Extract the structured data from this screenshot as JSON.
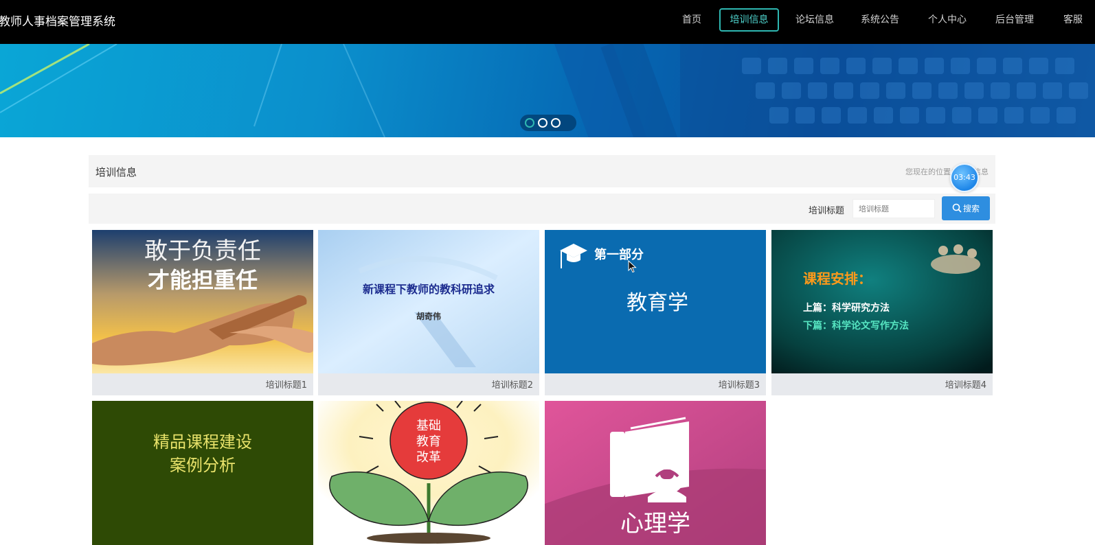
{
  "app": {
    "title": "教师人事档案管理系统"
  },
  "nav": {
    "items": [
      {
        "label": "首页",
        "active": false
      },
      {
        "label": "培训信息",
        "active": true
      },
      {
        "label": "论坛信息",
        "active": false
      },
      {
        "label": "系统公告",
        "active": false
      },
      {
        "label": "个人中心",
        "active": false
      },
      {
        "label": "后台管理",
        "active": false
      },
      {
        "label": "客服",
        "active": false
      }
    ]
  },
  "banner": {
    "slide_count": 3,
    "active_slide": 1
  },
  "section": {
    "title": "培训信息",
    "breadcrumb": "您现在的位置：培训信息"
  },
  "timer": {
    "text": "03:43"
  },
  "search": {
    "label": "培训标题",
    "placeholder": "培训标题",
    "button_label": "搜索"
  },
  "cards": [
    {
      "caption": "培训标题1",
      "image_text": [
        "敢于负责任",
        "才能担重任"
      ]
    },
    {
      "caption": "培训标题2",
      "image_text": [
        "新课程下教师的教科研追求",
        "胡奇伟"
      ]
    },
    {
      "caption": "培训标题3",
      "image_text": [
        "第一部分",
        "教育学"
      ]
    },
    {
      "caption": "培训标题4",
      "image_text": [
        "课程安排：",
        "上篇：科学研究方法",
        "下篇：科学论文写作方法"
      ]
    },
    {
      "caption": "",
      "image_text": [
        "精品课程建设",
        "案例分析"
      ]
    },
    {
      "caption": "",
      "image_text": [
        "基础",
        "教育",
        "改革"
      ]
    },
    {
      "caption": "",
      "image_text": [
        "心理学"
      ]
    }
  ],
  "colors": {
    "accent": "#2fb8b2",
    "search_button": "#2e8ee0",
    "nav_bg": "#000000",
    "panel_bg": "#f4f4f4"
  }
}
